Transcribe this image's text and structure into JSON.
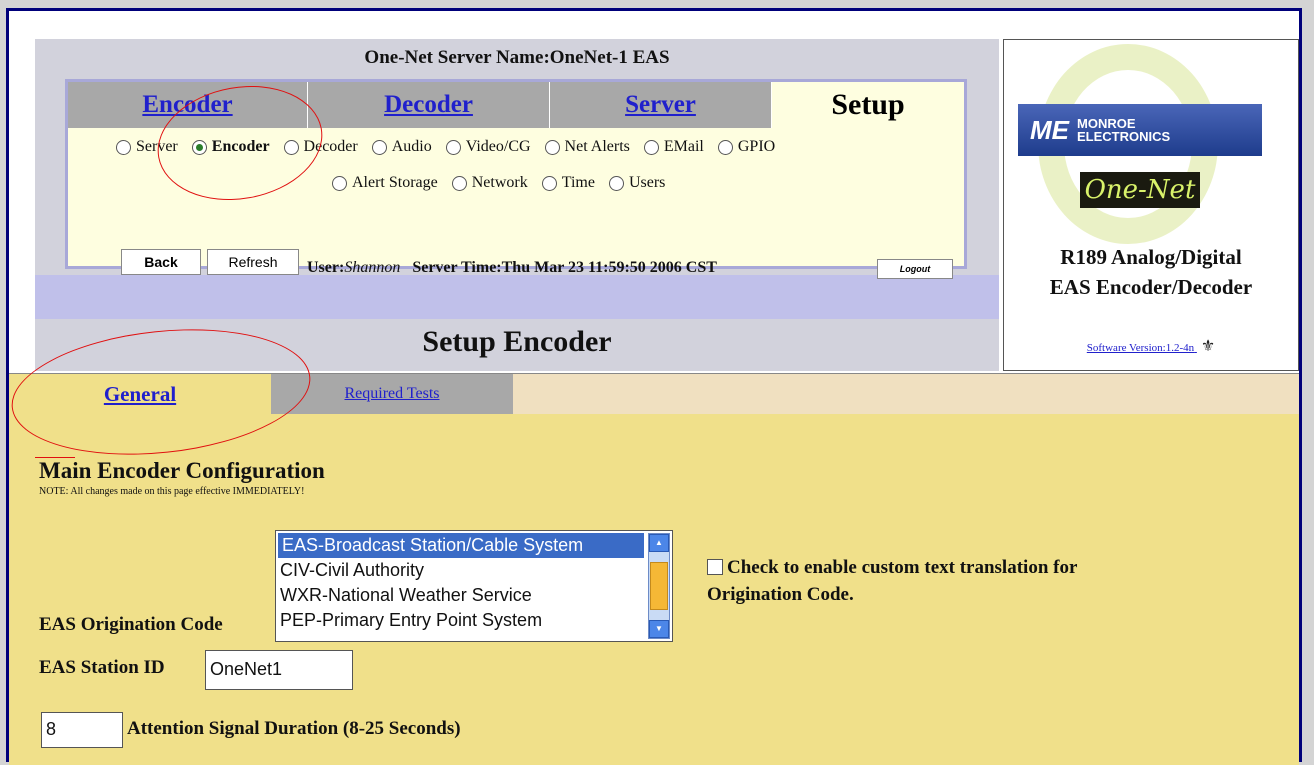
{
  "header": {
    "server_name": "One-Net Server Name:OneNet-1 EAS",
    "tabs": [
      {
        "label": "Encoder",
        "active": false
      },
      {
        "label": "Decoder",
        "active": false
      },
      {
        "label": "Server",
        "active": false
      },
      {
        "label": "Setup",
        "active": true
      }
    ],
    "radios_row1": [
      {
        "label": "Server",
        "selected": false
      },
      {
        "label": "Encoder",
        "selected": true
      },
      {
        "label": "Decoder",
        "selected": false
      },
      {
        "label": "Audio",
        "selected": false
      },
      {
        "label": "Video/CG",
        "selected": false
      },
      {
        "label": "Net Alerts",
        "selected": false
      },
      {
        "label": "EMail",
        "selected": false
      },
      {
        "label": "GPIO",
        "selected": false
      }
    ],
    "radios_row2": [
      {
        "label": "Alert Storage",
        "selected": false
      },
      {
        "label": "Network",
        "selected": false
      },
      {
        "label": "Time",
        "selected": false
      },
      {
        "label": "Users",
        "selected": false
      }
    ],
    "back_label": "Back",
    "refresh_label": "Refresh",
    "user_prefix": "User:",
    "user_name": "Shannon",
    "server_time": "Server Time:Thu Mar 23 11:59:50 2006 CST",
    "logout_label": "Logout",
    "page_title": "Setup Encoder"
  },
  "brand": {
    "logo_me": "ME",
    "logo_line1": "MONROE",
    "logo_line2": "ELECTRONICS",
    "onenet": "One-Net",
    "product_line1": "R189 Analog/Digital",
    "product_line2": "EAS Encoder/Decoder",
    "software_version": "Software Version:1.2-4n"
  },
  "subtabs": {
    "general": "General",
    "required": "Required Tests"
  },
  "form": {
    "heading": "Main Encoder Configuration",
    "note": "NOTE: All changes made on this page effective IMMEDIATELY!",
    "origination_label": "EAS Origination Code",
    "origination_options": [
      "EAS-Broadcast Station/Cable System",
      "CIV-Civil Authority",
      "WXR-National Weather Service",
      "PEP-Primary Entry Point System"
    ],
    "origination_selected": "EAS-Broadcast Station/Cable System",
    "custom_text_line1": "Check to enable custom text translation for",
    "custom_text_line2": "Origination Code.",
    "custom_text_checked": false,
    "station_label": "EAS Station ID",
    "station_value": "OneNet1",
    "attention_value": "8",
    "attention_label": "Attention Signal Duration (8-25 Seconds)"
  },
  "colors": {
    "content_bg": "#f0e08a",
    "link": "#2020cc",
    "annotation": "#e01010"
  }
}
